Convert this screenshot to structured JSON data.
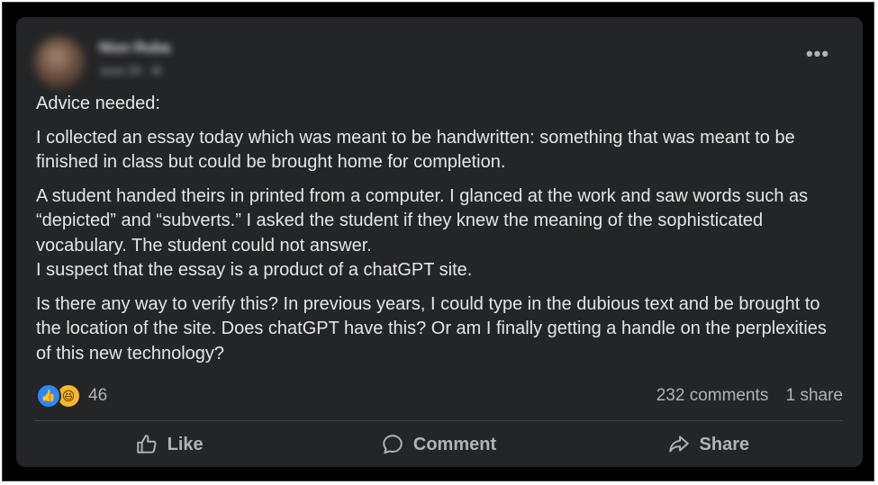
{
  "post": {
    "author": "Nisn Ruba",
    "meta": "June 29 · ⚙",
    "paragraphs": [
      "Advice needed:",
      "I collected an essay today which was meant to be handwritten: something that was meant to be finished in class but could be brought home for completion.",
      "A student handed theirs in printed from a computer. I glanced at the work and saw words such as “depicted” and “subverts.” I asked the student if they knew the meaning of the sophisticated vocabulary. The student could not answer.\nI suspect that the essay is a product of a chatGPT site.",
      "Is there any way to verify this? In previous years, I could type in the dubious text and be brought to the location of the site. Does chatGPT have this? Or am I finally getting a handle on the perplexities of this new technology?"
    ]
  },
  "reactions": {
    "count": "46",
    "icons": [
      "like-icon",
      "haha-icon"
    ]
  },
  "stats": {
    "comments": "232 comments",
    "shares": "1 share"
  },
  "actions": {
    "like": "Like",
    "comment": "Comment",
    "share": "Share"
  },
  "more_icon": "•••",
  "colors": {
    "card_bg": "#242526",
    "text": "#e4e6eb",
    "secondary": "#b0b3b8",
    "like_blue": "#2d88ff",
    "haha_yellow": "#f7b928"
  }
}
